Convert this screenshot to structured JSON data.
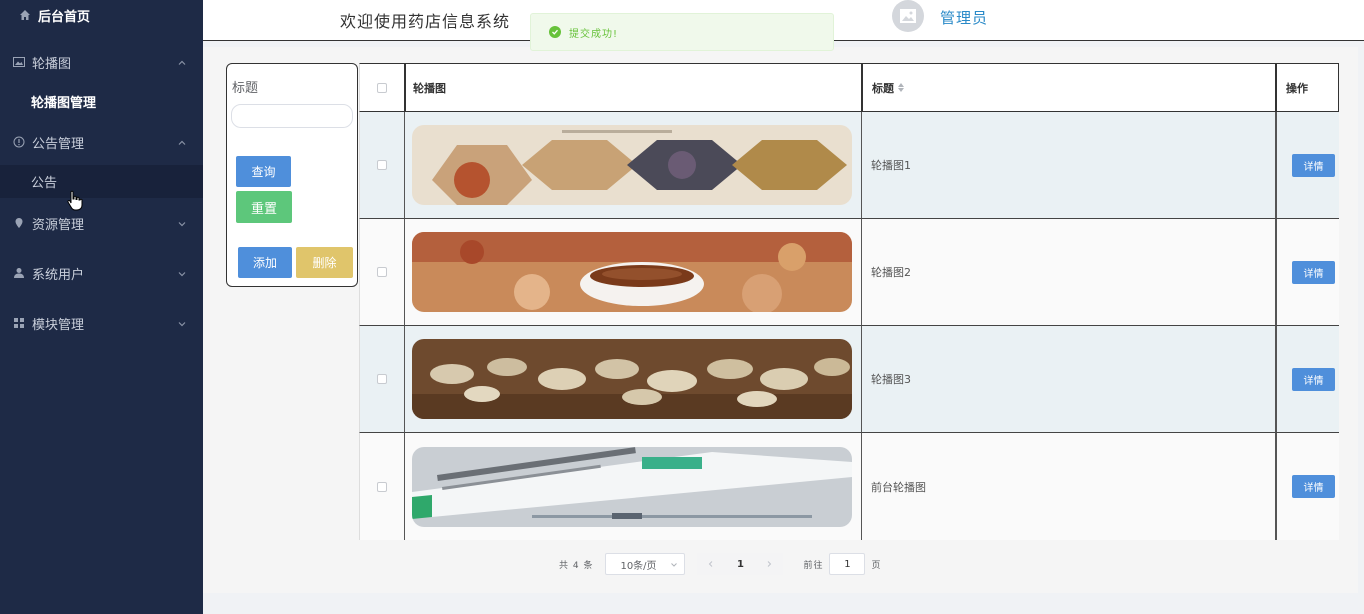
{
  "sidebar": {
    "home": "后台首页",
    "groups": [
      {
        "label": "轮播图",
        "children": [
          "轮播图管理"
        ]
      },
      {
        "label": "公告管理",
        "children": [
          "公告"
        ]
      },
      {
        "label": "资源管理"
      },
      {
        "label": "系统用户"
      },
      {
        "label": "模块管理"
      }
    ]
  },
  "header": {
    "welcome": "欢迎使用药店信息系统",
    "user": "管理员"
  },
  "toast": {
    "text": "提交成功!"
  },
  "filter": {
    "label": "标题",
    "query_label": "查询",
    "reset_label": "重置",
    "add_label": "添加",
    "delete_label": "删除"
  },
  "table": {
    "columns": [
      "轮播图",
      "标题",
      "操作"
    ],
    "rows": [
      {
        "title": "轮播图1",
        "action": "详情",
        "image": "herbs-hexagon-banner"
      },
      {
        "title": "轮播图2",
        "action": "详情",
        "image": "herbal-tea-bowl-banner"
      },
      {
        "title": "轮播图3",
        "action": "详情",
        "image": "sliced-roots-banner"
      },
      {
        "title": "前台轮播图",
        "action": "详情",
        "image": "vaccine-box-banner"
      }
    ]
  },
  "pager": {
    "total": "共 4 条",
    "page_size": "10条/页",
    "current": "1",
    "goto": "前往",
    "goto_value": "1",
    "unit": "页"
  },
  "colors": {
    "sidebar_bg": "#1e2a46",
    "primary": "#4f8fdb",
    "success": "#5dc77b",
    "warning": "#e0c56b",
    "toast_green": "#67c23a"
  }
}
